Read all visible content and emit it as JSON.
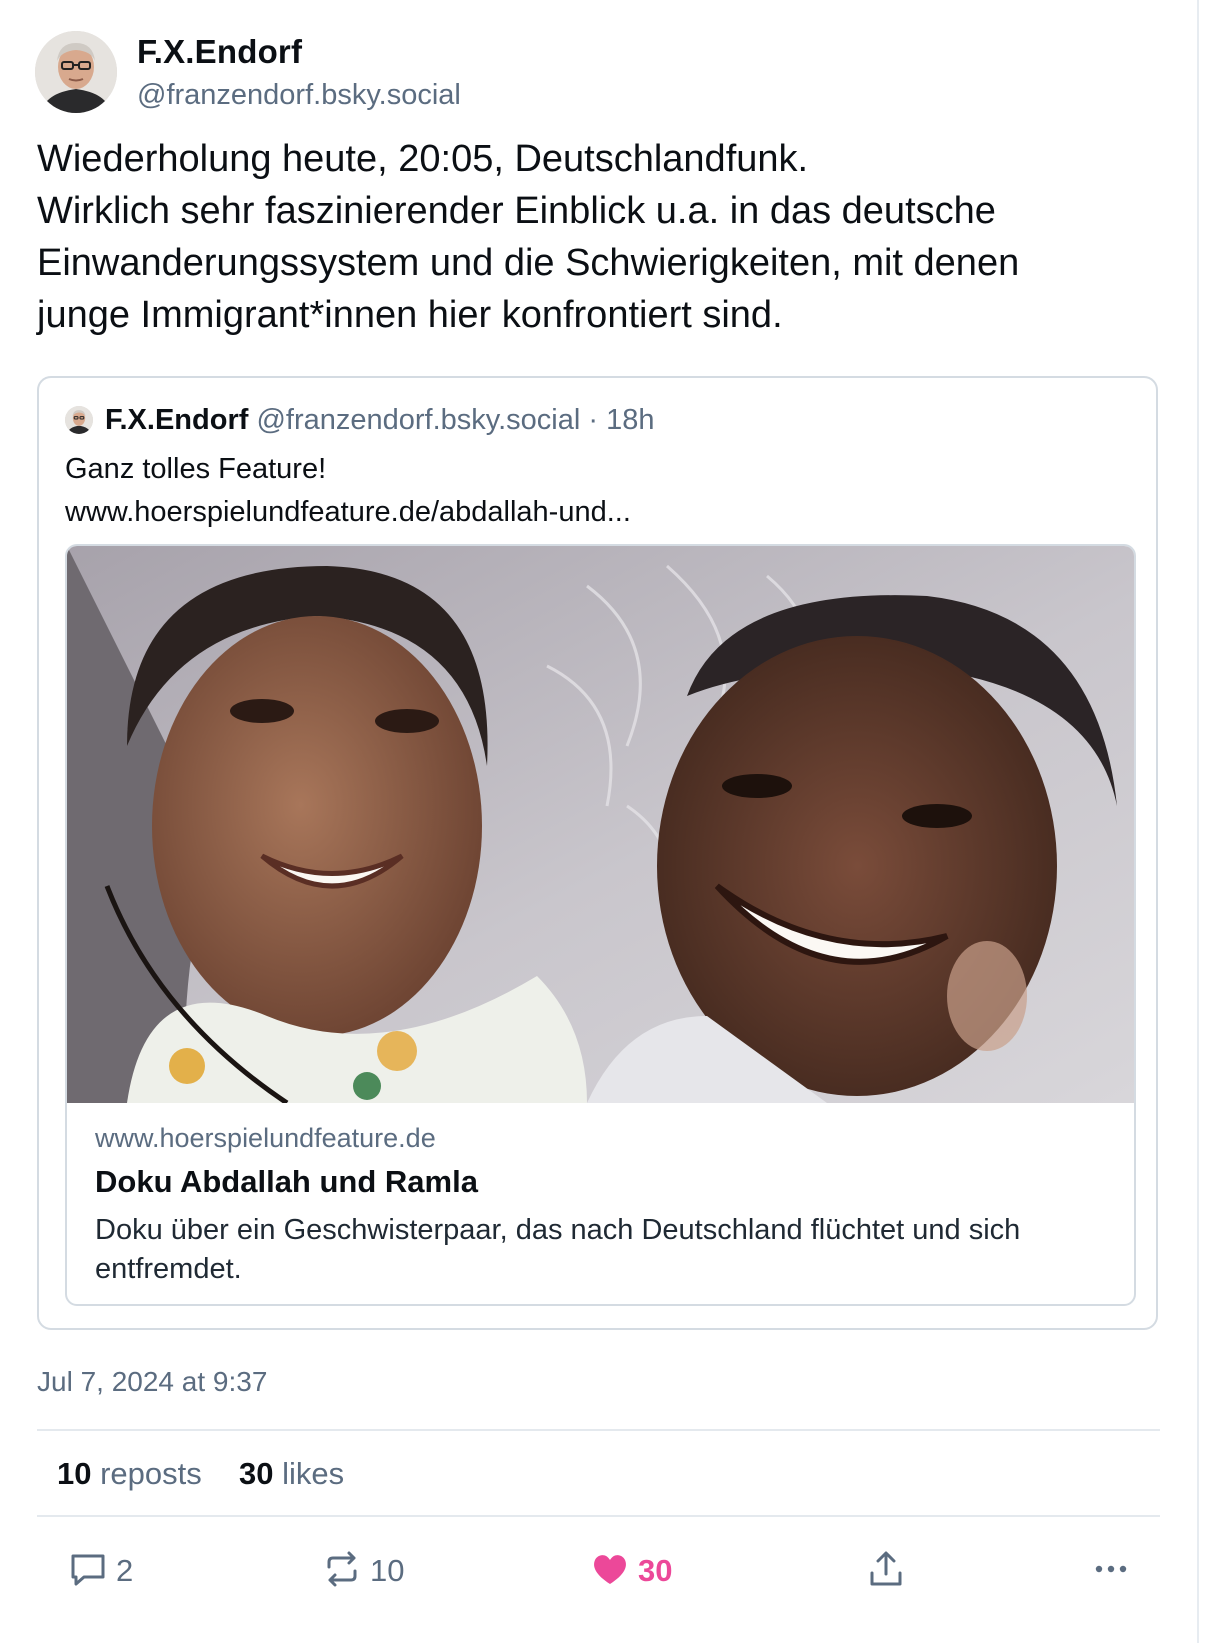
{
  "author": {
    "name": "F.X.Endorf",
    "handle": "@franzendorf.bsky.social"
  },
  "post": {
    "lines": [
      "Wiederholung heute, 20:05, Deutschlandfunk.",
      "Wirklich sehr faszinierender Einblick u.a. in das deutsche",
      "Einwanderungssystem und die Schwierigkeiten, mit denen",
      "junge Immigrant*innen hier konfrontiert sind."
    ],
    "timestamp": "Jul 7, 2024 at 9:37"
  },
  "quote": {
    "name": "F.X.Endorf",
    "meta": "@franzendorf.bsky.social · 18h",
    "text_line1": "Ganz tolles Feature!",
    "text_line2": "www.hoerspielundfeature.de/abdallah-und...",
    "card": {
      "domain": "www.hoerspielundfeature.de",
      "title": "Doku Abdallah und Ramla",
      "description": "Doku über ein Geschwisterpaar, das nach Deutschland flüchtet und sich entfremdet."
    }
  },
  "stats": {
    "reposts_count": "10",
    "reposts_label": "reposts",
    "likes_count": "30",
    "likes_label": "likes"
  },
  "actions": {
    "reply_count": "2",
    "repost_count": "10",
    "like_count": "30",
    "like_color": "#ec4899",
    "icons": [
      "reply-icon",
      "repost-icon",
      "heart-icon",
      "share-icon",
      "more-icon"
    ]
  }
}
